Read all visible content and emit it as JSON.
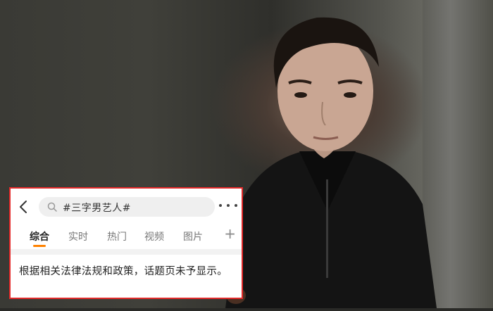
{
  "search": {
    "query": "#三字男艺人#"
  },
  "tabs": [
    {
      "label": "综合"
    },
    {
      "label": "实时"
    },
    {
      "label": "热门"
    },
    {
      "label": "视频"
    },
    {
      "label": "图片"
    }
  ],
  "add_tab_label": "+",
  "notice_text": "根据相关法律法规和政策，话题页未予显示。",
  "colors": {
    "accent_underline": "#ff8200",
    "highlight_border": "#e52a2a",
    "search_box_bg": "#efefef"
  }
}
